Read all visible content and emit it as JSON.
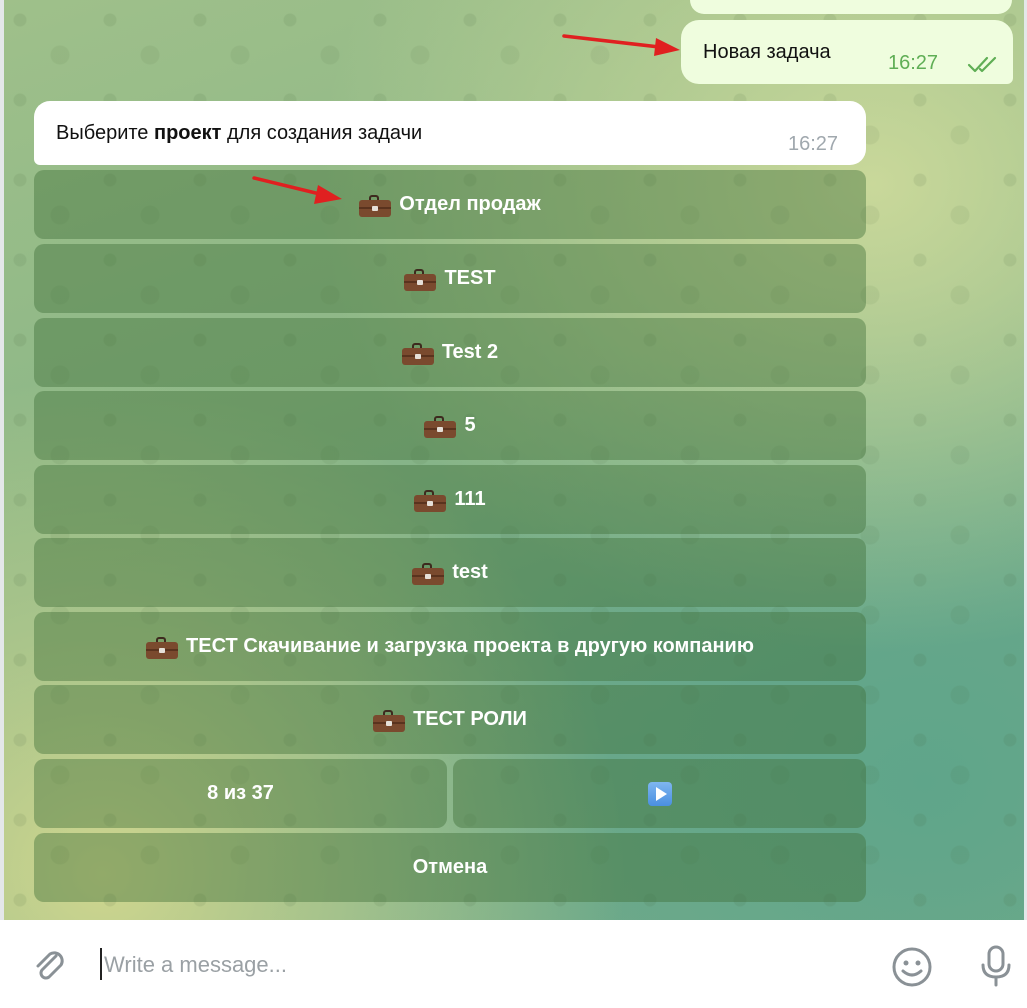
{
  "chat": {
    "outgoing": {
      "text": "Новая задача",
      "time": "16:27"
    },
    "incoming": {
      "text_prefix": "Выберите ",
      "text_bold": "проект",
      "text_suffix": " для создания задачи",
      "time": "16:27"
    }
  },
  "keyboard": {
    "projects": [
      {
        "label": "Отдел продаж",
        "icon": "briefcase-icon"
      },
      {
        "label": "TEST",
        "icon": "briefcase-icon"
      },
      {
        "label": "Test 2",
        "icon": "briefcase-icon"
      },
      {
        "label": "5",
        "icon": "briefcase-icon"
      },
      {
        "label": "111",
        "icon": "briefcase-icon"
      },
      {
        "label": "test",
        "icon": "briefcase-icon"
      },
      {
        "label": "ТЕСТ Скачивание и загрузка проекта в другую компанию",
        "icon": "briefcase-icon"
      },
      {
        "label": "ТЕСТ РОЛИ",
        "icon": "briefcase-icon"
      }
    ],
    "pagination": {
      "label": "8 из 37",
      "next_icon": "play-icon"
    },
    "cancel": "Отмена"
  },
  "composer": {
    "placeholder": "Write a message...",
    "attach_icon": "paperclip-icon",
    "emoji_icon": "smiley-icon",
    "mic_icon": "microphone-icon"
  },
  "colors": {
    "outgoing_bubble": "#effdde",
    "incoming_bubble": "#ffffff",
    "keyboard_button": "rgba(63,110,56,0.42)",
    "time_outgoing": "#5fae55",
    "annotation_arrow": "#e02020"
  }
}
